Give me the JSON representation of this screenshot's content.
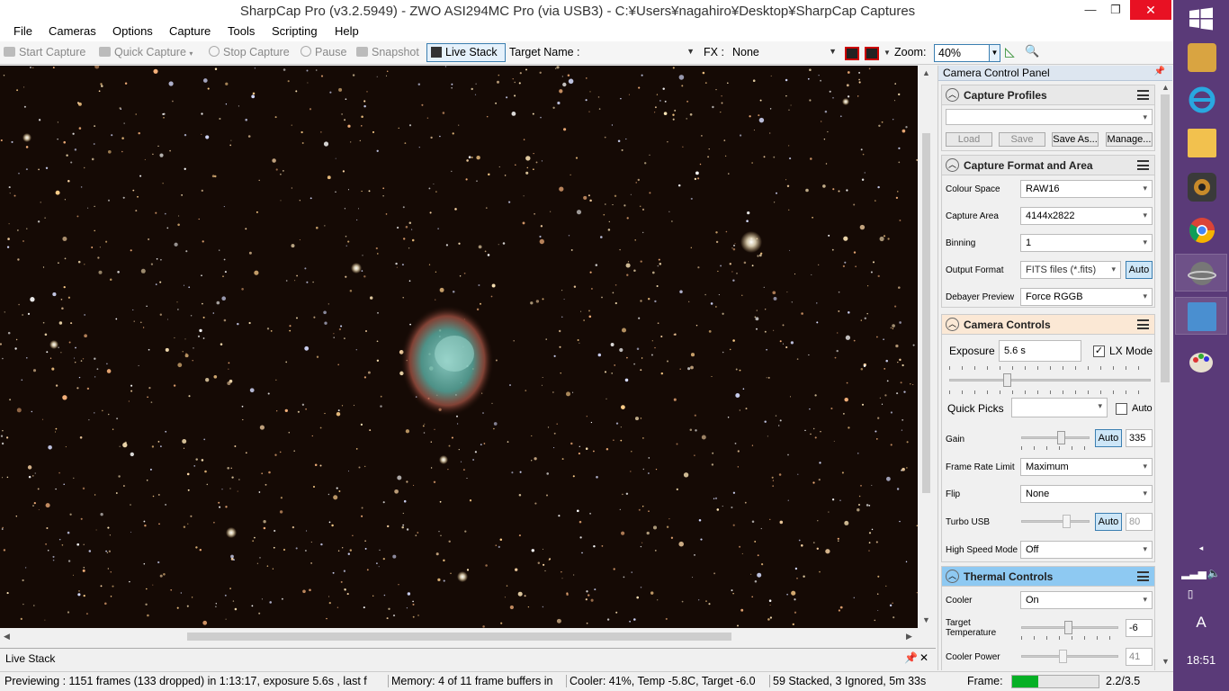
{
  "window": {
    "title": "SharpCap Pro (v3.2.5949) - ZWO ASI294MC Pro (via USB3) - C:¥Users¥nagahiro¥Desktop¥SharpCap Captures",
    "minimize": "—",
    "maximize": "❐",
    "close": "✕"
  },
  "menu": [
    "File",
    "Cameras",
    "Options",
    "Capture",
    "Tools",
    "Scripting",
    "Help"
  ],
  "toolbar": {
    "start_capture": "Start Capture",
    "quick_capture": "Quick Capture",
    "stop_capture": "Stop Capture",
    "pause": "Pause",
    "snapshot": "Snapshot",
    "live_stack": "Live Stack",
    "target_name_label": "Target Name :",
    "fx_label": "FX :",
    "fx_value": "None",
    "zoom_label": "Zoom:",
    "zoom_value": "40%"
  },
  "panel": {
    "header": "Camera Control Panel",
    "pin": "📌",
    "capture_profiles": {
      "title": "Capture Profiles",
      "load": "Load",
      "save": "Save",
      "save_as": "Save As...",
      "manage": "Manage..."
    },
    "capture_format": {
      "title": "Capture Format and Area",
      "colour_space_label": "Colour Space",
      "colour_space": "RAW16",
      "capture_area_label": "Capture Area",
      "capture_area": "4144x2822",
      "binning_label": "Binning",
      "binning": "1",
      "output_format_label": "Output Format",
      "output_format": "FITS files (*.fits)",
      "output_auto": "Auto",
      "debayer_label": "Debayer Preview",
      "debayer": "Force RGGB"
    },
    "camera_controls": {
      "title": "Camera Controls",
      "exposure_label": "Exposure",
      "exposure": "5.6 s",
      "lx_mode": "LX Mode",
      "quick_picks_label": "Quick Picks",
      "quick_auto": "Auto",
      "gain_label": "Gain",
      "gain_auto": "Auto",
      "gain": "335",
      "frame_rate_label": "Frame Rate Limit",
      "frame_rate": "Maximum",
      "flip_label": "Flip",
      "flip": "None",
      "turbo_label": "Turbo USB",
      "turbo_auto": "Auto",
      "turbo": "80",
      "high_speed_label": "High Speed Mode",
      "high_speed": "Off"
    },
    "thermal": {
      "title": "Thermal Controls",
      "cooler_label": "Cooler",
      "cooler": "On",
      "target_temp_label": "Target Temperature",
      "target_temp": "-6",
      "cooler_power_label": "Cooler Power",
      "cooler_power": "41"
    }
  },
  "live_stack_panel": {
    "title": "Live Stack",
    "pin": "📌",
    "close": "✕"
  },
  "status": {
    "preview": "Previewing : 1151 frames (133 dropped) in 1:13:17, exposure 5.6s , last f",
    "memory": "Memory: 4 of 11 frame buffers in",
    "cooler": "Cooler: 41%, Temp -5.8C, Target -6.0",
    "stacked": "59 Stacked, 3 Ignored, 5m 33s",
    "frame_label": "Frame:",
    "frame_progress": 0.3,
    "frame_value": "2.2/3.5"
  },
  "taskbar": {
    "clock": "18:51",
    "ime": "A",
    "expand": "◂"
  }
}
